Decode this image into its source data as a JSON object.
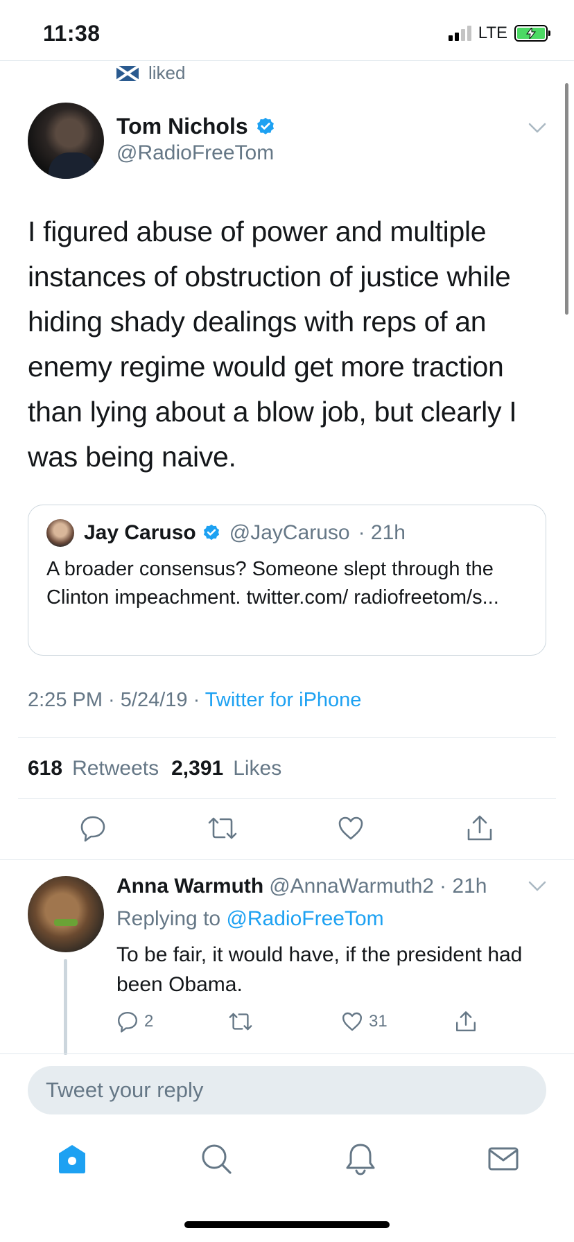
{
  "status_bar": {
    "time": "11:38",
    "network": "LTE",
    "signal_bars_active": 2,
    "signal_bars_total": 4,
    "battery": "charging"
  },
  "context": {
    "liked_label": "liked"
  },
  "tweet": {
    "author_name": "Tom Nichols",
    "author_handle": "@RadioFreeTom",
    "verified": true,
    "text": "I figured abuse of power and multiple instances of obstruction of justice while hiding shady dealings with reps of an enemy regime would get more traction than lying about a blow job, but clearly I was being naive.",
    "quote": {
      "author_name": "Jay Caruso",
      "author_handle": "@JayCaruso",
      "time": "· 21h",
      "text": "A broader consensus? Someone slept through the Clinton impeachment. twitter.com/ radiofreetom/s..."
    },
    "timestamp": "2:25 PM · 5/24/19 · ",
    "source": "Twitter for iPhone",
    "retweets_count": "618",
    "retweets_label": "Retweets",
    "likes_count": "2,391",
    "likes_label": "Likes"
  },
  "reply": {
    "author_name": "Anna Warmuth",
    "author_handle": "@AnnaWarmuth2",
    "time": "· 21h",
    "replying_prefix": "Replying to",
    "replying_to": "@RadioFreeTom",
    "text": "To be fair, it would have, if the president had been Obama.",
    "reply_count": "2",
    "like_count": "31"
  },
  "composer": {
    "placeholder": "Tweet your reply"
  },
  "tabs": [
    "home",
    "search",
    "notifications",
    "messages"
  ],
  "colors": {
    "accent": "#1da1f2",
    "text": "#14171a",
    "secondary_text": "#657786",
    "divider": "#e1e8ed",
    "input_bg": "#e6ecf0"
  }
}
